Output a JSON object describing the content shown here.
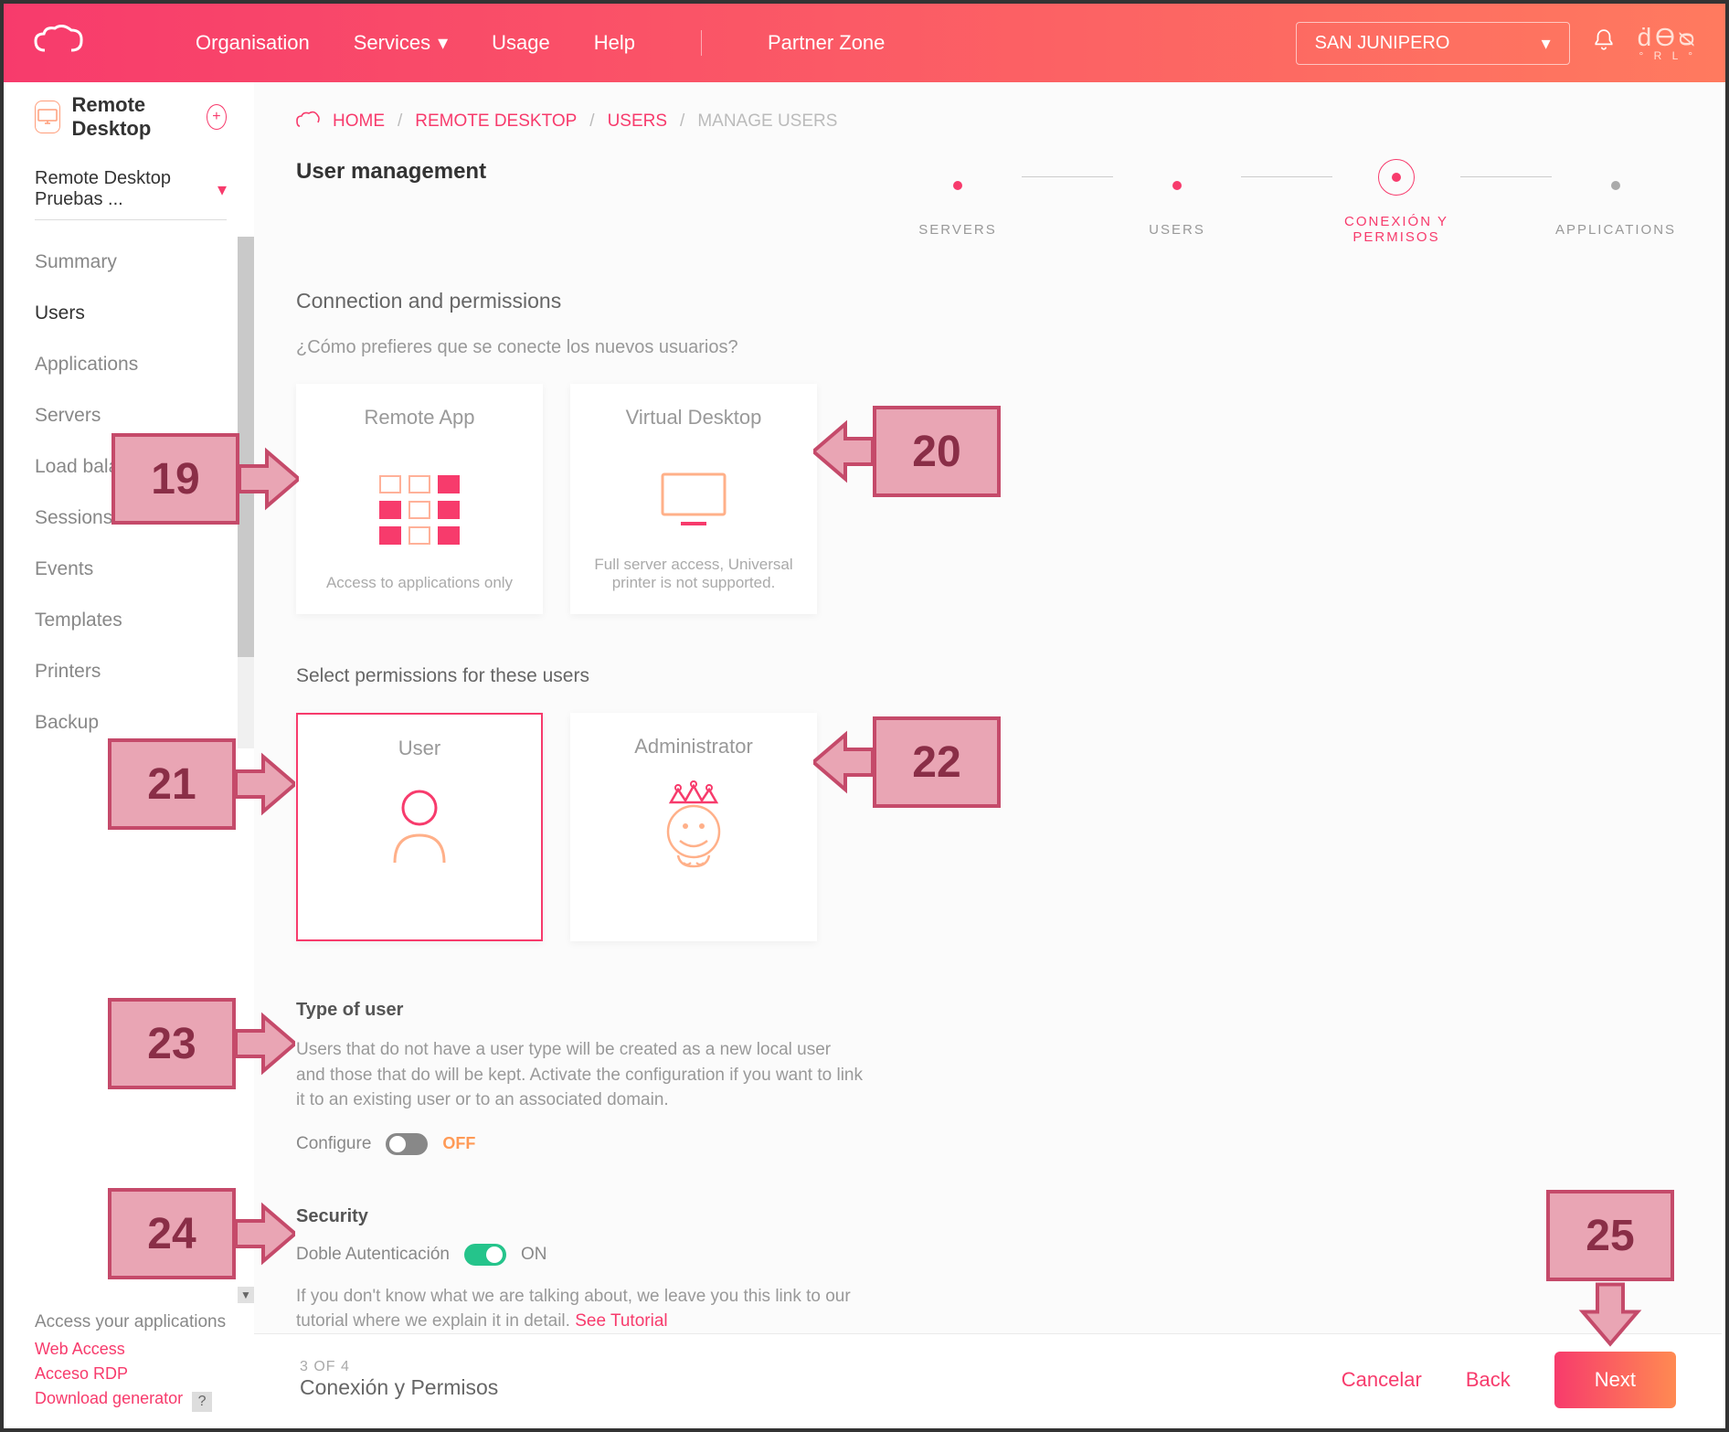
{
  "header": {
    "nav": {
      "org": "Organisation",
      "services": "Services",
      "usage": "Usage",
      "help": "Help",
      "partner": "Partner Zone"
    },
    "org_select": "SAN JUNIPERO"
  },
  "sidebar": {
    "product": "Remote Desktop",
    "project": "Remote Desktop Pruebas ...",
    "items": [
      "Summary",
      "Users",
      "Applications",
      "Servers",
      "Load balancer",
      "Sessions",
      "Events",
      "Templates",
      "Printers",
      "Backup"
    ],
    "access": {
      "title": "Access your applications",
      "web": "Web Access",
      "rdp": "Acceso RDP",
      "download": "Download generator"
    }
  },
  "breadcrumb": {
    "home": "HOME",
    "rd": "REMOTE DESKTOP",
    "users": "USERS",
    "manage": "MANAGE USERS"
  },
  "page": {
    "title": "User management",
    "steps": [
      "SERVERS",
      "USERS",
      "CONEXIÓN Y PERMISOS",
      "APPLICATIONS"
    ]
  },
  "conn": {
    "heading": "Connection and permissions",
    "question": "¿Cómo prefieres que se conecte los nuevos usuarios?",
    "remote_title": "Remote App",
    "remote_desc": "Access to applications only",
    "vd_title": "Virtual Desktop",
    "vd_desc": "Full server access, Universal printer is not supported."
  },
  "perm": {
    "heading": "Select permissions for these users",
    "user": "User",
    "admin": "Administrator"
  },
  "type": {
    "title": "Type of user",
    "desc": "Users that do not have a user type will be created as a new local user and those that do will be kept. Activate the configuration if you want to link it to an existing user or to an associated domain.",
    "configure": "Configure",
    "off": "OFF"
  },
  "security": {
    "title": "Security",
    "twofa": "Doble Autenticación",
    "on": "ON",
    "desc_a": "If you don't know what we are talking about, we leave you this link to our tutorial where we explain it in detail. ",
    "tutorial": "See Tutorial"
  },
  "footer": {
    "step_num": "3 OF 4",
    "step_name": "Conexión y Permisos",
    "cancel": "Cancelar",
    "back": "Back",
    "next": "Next"
  },
  "anno": {
    "n19": "19",
    "n20": "20",
    "n21": "21",
    "n22": "22",
    "n23": "23",
    "n24": "24",
    "n25": "25"
  }
}
